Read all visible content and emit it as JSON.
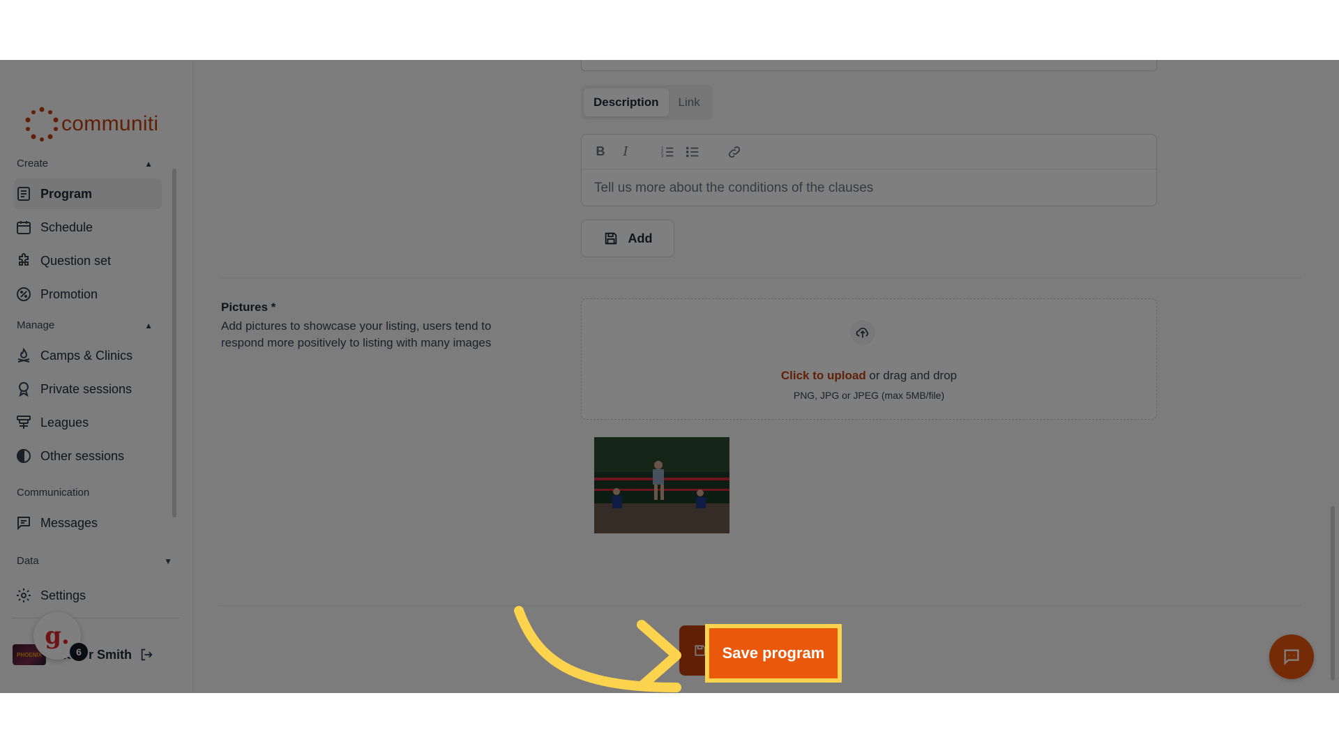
{
  "brand": {
    "name": "communiti",
    "color": "#c2410c"
  },
  "sidebar": {
    "sections": [
      {
        "label": "Create",
        "expanded": true
      },
      {
        "label": "Manage",
        "expanded": true
      },
      {
        "label": "Communication"
      },
      {
        "label": "Data",
        "expanded": false
      }
    ],
    "create_items": [
      {
        "label": "Program",
        "icon": "document-list-icon",
        "active": true
      },
      {
        "label": "Schedule",
        "icon": "calendar-icon"
      },
      {
        "label": "Question set",
        "icon": "puzzle-icon"
      },
      {
        "label": "Promotion",
        "icon": "percent-badge-icon"
      }
    ],
    "manage_items": [
      {
        "label": "Camps & Clinics",
        "icon": "campfire-icon"
      },
      {
        "label": "Private sessions",
        "icon": "award-icon"
      },
      {
        "label": "Leagues",
        "icon": "bracket-icon"
      },
      {
        "label": "Other sessions",
        "icon": "half-circle-icon"
      }
    ],
    "communication_items": [
      {
        "label": "Messages",
        "icon": "message-icon"
      }
    ],
    "settings": {
      "label": "Settings",
      "icon": "gear-icon"
    },
    "user": {
      "name": "Roger Smith",
      "avatar_text": "PHOENIX",
      "notification_count": "6",
      "assistant_badge": "g."
    }
  },
  "form": {
    "tabs": [
      {
        "label": "Description",
        "active": true
      },
      {
        "label": "Link",
        "active": false
      }
    ],
    "editor": {
      "placeholder": "Tell us more about the conditions of the clauses",
      "toolbar": [
        "bold-icon",
        "italic-icon",
        "ordered-list-icon",
        "bullet-list-icon",
        "link-icon"
      ]
    },
    "add_button": "Add",
    "pictures": {
      "title": "Pictures *",
      "description": "Add pictures to showcase your listing, users tend to respond more positively to listing with many images",
      "upload_link": "Click to upload",
      "upload_text": " or drag and drop",
      "upload_hint": "PNG, JPG or JPEG (max 5MB/file)"
    },
    "save_button": "Save program"
  },
  "colors": {
    "accent": "#ea580c",
    "highlight": "#fcd34d"
  }
}
